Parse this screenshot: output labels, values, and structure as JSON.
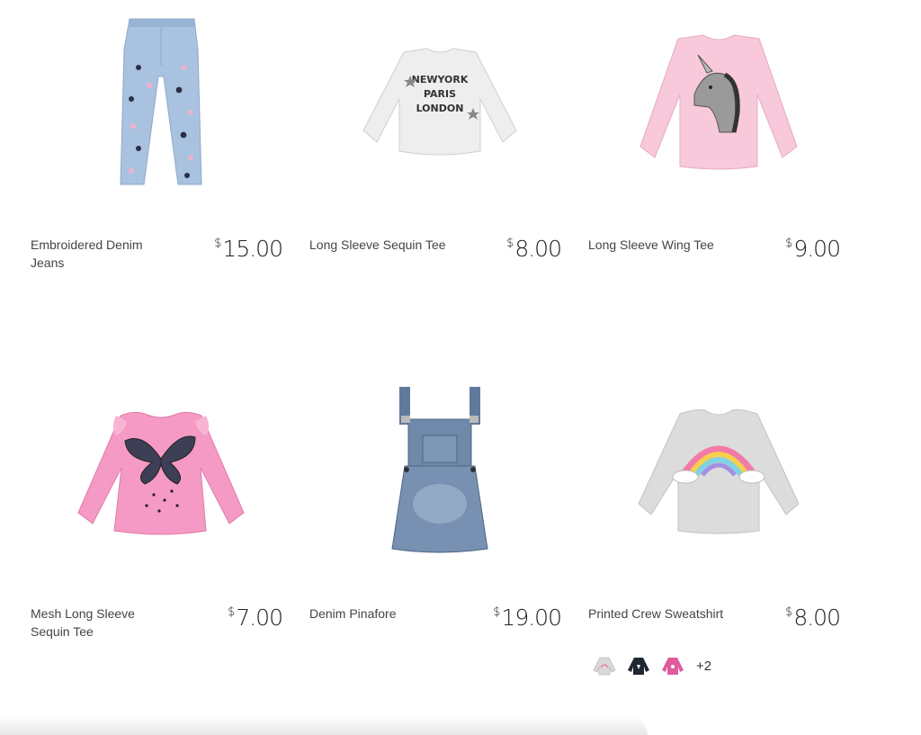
{
  "products": [
    {
      "name": "Embroidered Denim Jeans",
      "currency": "$",
      "price": "15.00",
      "image": "denim-jeans-image"
    },
    {
      "name": "Long Sleeve Sequin Tee",
      "currency": "$",
      "price": "8.00",
      "image": "sequin-tee-image",
      "print_lines": [
        "NEWYORK",
        "PARIS",
        "LONDON"
      ]
    },
    {
      "name": "Long Sleeve Wing Tee",
      "currency": "$",
      "price": "9.00",
      "image": "unicorn-tee-image"
    },
    {
      "name": "Mesh Long Sleeve Sequin Tee",
      "currency": "$",
      "price": "7.00",
      "image": "butterfly-tee-image"
    },
    {
      "name": "Denim Pinafore",
      "currency": "$",
      "price": "19.00",
      "image": "denim-pinafore-image"
    },
    {
      "name": "Printed Crew Sweatshirt",
      "currency": "$",
      "price": "8.00",
      "image": "rainbow-sweatshirt-image"
    }
  ],
  "swatches": {
    "items": [
      {
        "name": "grey-sweatshirt-swatch",
        "color": "#d9d9d9"
      },
      {
        "name": "navy-sweatshirt-swatch",
        "color": "#1f2733"
      },
      {
        "name": "pink-sweatshirt-swatch",
        "color": "#e05a9c"
      }
    ],
    "more_label": "+2"
  },
  "colors": {
    "denim_light": "#a9c2e0",
    "denim_dark": "#5f7a9c",
    "pink": "#f7bfd6",
    "bright_pink": "#f59ac4",
    "grey": "#dcdcdc"
  }
}
